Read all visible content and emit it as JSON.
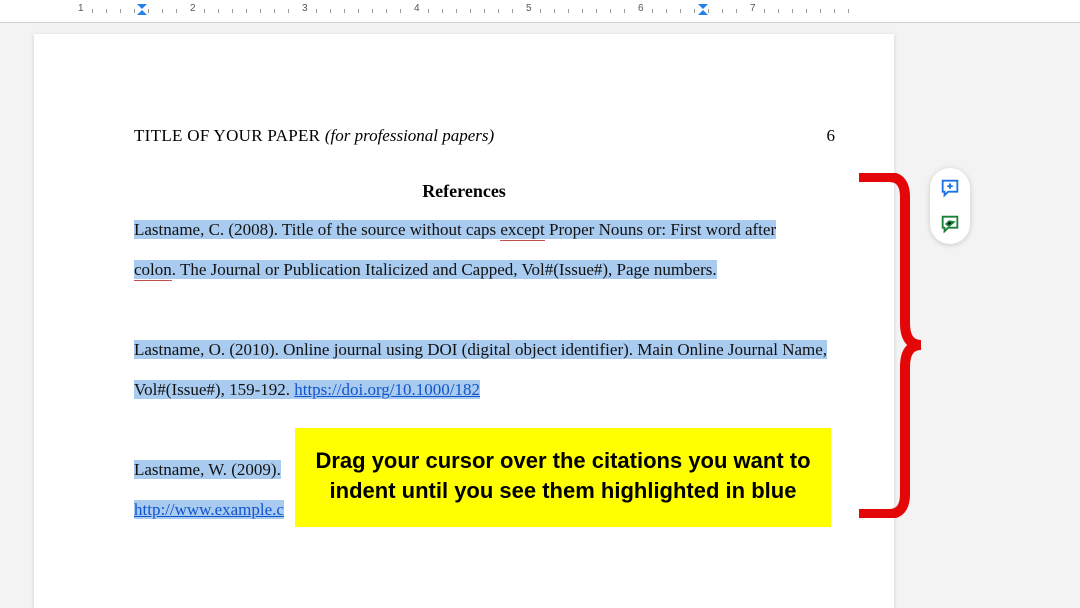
{
  "ruler": {
    "labels": [
      "1",
      "2",
      "3",
      "4",
      "5",
      "6",
      "7"
    ]
  },
  "header": {
    "title_upper": "TITLE OF YOUR PAPER ",
    "title_italic": "(for professional papers)",
    "page_number": "6"
  },
  "references_heading": "References",
  "citations": [
    {
      "pre": "Lastname, C. (2008). Title of the source without caps ",
      "wavy1": "except",
      "mid": " Proper Nouns or: First word after ",
      "wavy2": "colon",
      "post": ". The Journal or Publication Italicized and Capped, Vol#(Issue#), Page numbers."
    },
    {
      "pre": "Lastname, O. (2010). Online journal using DOI (digital object identifier). Main Online Journal Name, Vol#(Issue#), 159-192. ",
      "link": "https://doi.org/10.1000/182"
    },
    {
      "pre": "Lastname, W. (2009). ",
      "link_visible": "http://www.example.c"
    }
  ],
  "callout": "Drag your cursor over the citations you want to indent until you see them highlighted in blue",
  "toolbar": {
    "add_comment": "Add comment",
    "suggest_edits": "Suggest edits"
  }
}
